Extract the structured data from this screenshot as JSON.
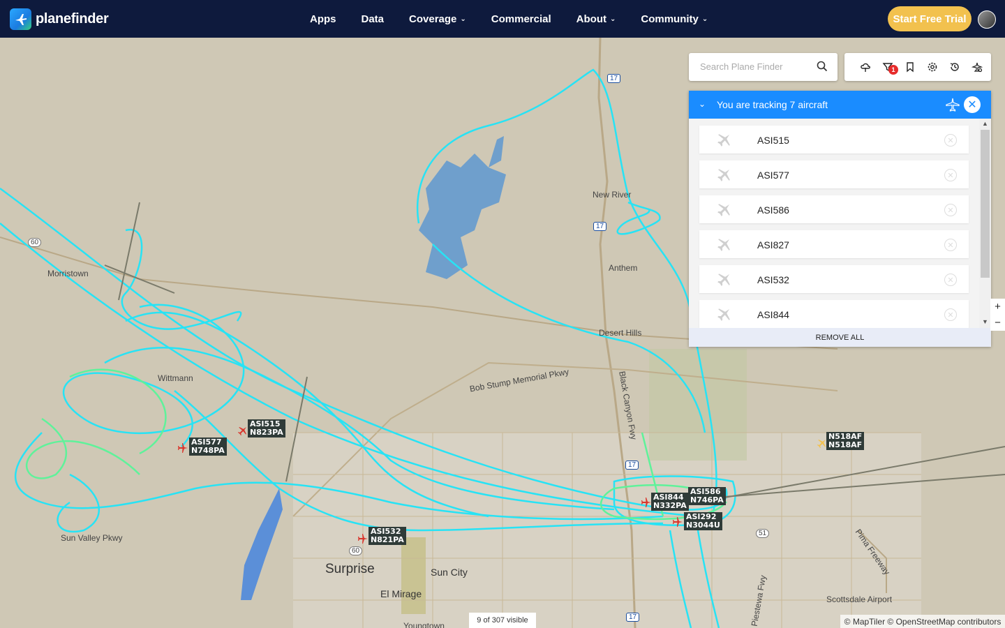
{
  "nav": {
    "brand": "planefinder",
    "menu": [
      {
        "label": "Apps",
        "dropdown": false
      },
      {
        "label": "Data",
        "dropdown": false
      },
      {
        "label": "Coverage",
        "dropdown": true
      },
      {
        "label": "Commercial",
        "dropdown": false
      },
      {
        "label": "About",
        "dropdown": true
      },
      {
        "label": "Community",
        "dropdown": true
      }
    ],
    "cta": "Start Free Trial"
  },
  "search": {
    "placeholder": "Search Plane Finder"
  },
  "toolbar": {
    "icons": [
      "weather-icon",
      "filter-icon",
      "bookmark-icon",
      "settings-icon",
      "history-icon",
      "playback-icon"
    ],
    "filter_badge": "1"
  },
  "tracking": {
    "title": "You are tracking 7 aircraft",
    "aircraft": [
      "ASI515",
      "ASI577",
      "ASI586",
      "ASI827",
      "ASI532",
      "ASI844"
    ],
    "remove_all": "REMOVE ALL"
  },
  "zoom": {
    "in": "+",
    "out": "−"
  },
  "map": {
    "places": [
      "Morristown",
      "New River",
      "Anthem",
      "Desert Hills",
      "Sun Valley Pkwy",
      "Surprise",
      "Sun City",
      "El Mirage",
      "Youngtown",
      "Scottsdale Airport",
      "Bob Stump Memorial Pkwy",
      "Black Canyon Fwy",
      "Pima Freeway",
      "Piestewa Fwy",
      "Wittmann"
    ],
    "highways": [
      "60",
      "17",
      "17",
      "17",
      "17",
      "51",
      "60"
    ],
    "aircraft_tags": [
      {
        "callsign": "ASI515",
        "reg": "N823PA"
      },
      {
        "callsign": "ASI577",
        "reg": "N748PA"
      },
      {
        "callsign": "ASI532",
        "reg": "N821PA"
      },
      {
        "callsign": "ASI844",
        "reg": "N332PA"
      },
      {
        "callsign": "ASI586",
        "reg": "N746PA"
      },
      {
        "callsign": "ASI292",
        "reg": "N3044U"
      },
      {
        "callsign": "N518AF",
        "reg": "N518AF"
      }
    ]
  },
  "status": {
    "visible": "9 of 307 visible"
  },
  "attribution": "© MapTiler © OpenStreetMap contributors",
  "colors": {
    "nav": "#0e1a3d",
    "cta": "#f2c14e",
    "panel_header": "#1a8cff",
    "track": "#27e3f5",
    "track_alt": "#5ff29a",
    "water": "#6f9fcc"
  }
}
